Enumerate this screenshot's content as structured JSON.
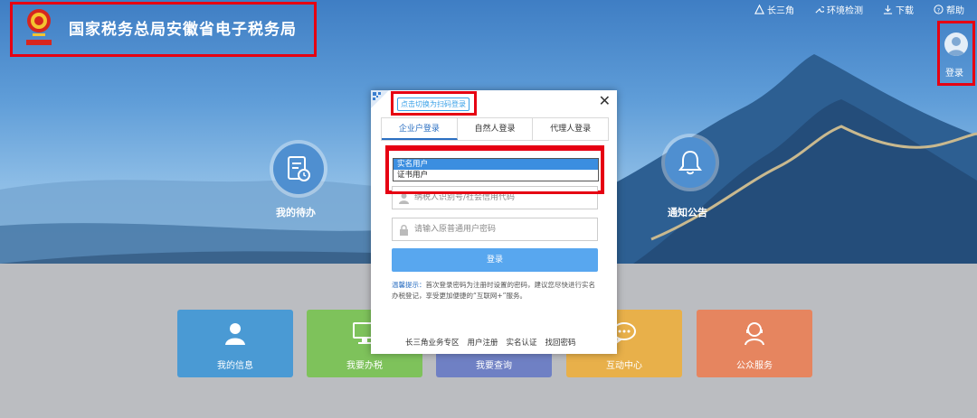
{
  "header": {
    "title": "国家税务总局安徽省电子税务局",
    "nav": [
      {
        "label": "长三角",
        "icon": "triangle-icon"
      },
      {
        "label": "环境检测",
        "icon": "wrench-icon"
      },
      {
        "label": "下载",
        "icon": "download-icon"
      },
      {
        "label": "帮助",
        "icon": "help-icon"
      }
    ],
    "login_label": "登录"
  },
  "hero": {
    "items": [
      {
        "label": "我的待办",
        "icon": "todo-document-icon"
      },
      {
        "label": "通知公告",
        "icon": "bell-icon"
      }
    ]
  },
  "tiles": [
    {
      "label": "我的信息",
      "color": "#4a9ad4",
      "icon": "user-icon"
    },
    {
      "label": "我要办税",
      "color": "#7ec25b",
      "icon": "monitor-icon"
    },
    {
      "label": "我要查询",
      "color": "#6f80c4",
      "icon": "search-icon"
    },
    {
      "label": "互动中心",
      "color": "#e8b04a",
      "icon": "chat-icon"
    },
    {
      "label": "公众服务",
      "color": "#e6855f",
      "icon": "service-icon"
    }
  ],
  "dialog": {
    "qr_switch": "点击切换为扫码登录",
    "tabs": [
      "企业户登录",
      "自然人登录",
      "代理人登录"
    ],
    "active_tab": 0,
    "user_type_options": [
      "实名用户",
      "证书用户"
    ],
    "selected_option": 0,
    "taxpayer_placeholder": "纳税人识别号/社会信用代码",
    "password_placeholder": "请输入原普通用户密码",
    "login_button": "登录",
    "tip_label": "温馨提示：",
    "tip_text": "首次登录密码为注册时设置的密码，建议您尽快进行实名办税登记，享受更加便捷的“互联网+”服务。",
    "links": [
      "长三角业务专区",
      "用户注册",
      "实名认证",
      "找回密码"
    ]
  },
  "colors": {
    "accent": "#2b6fc2",
    "button": "#58a7ef",
    "highlight": "#e60012"
  }
}
